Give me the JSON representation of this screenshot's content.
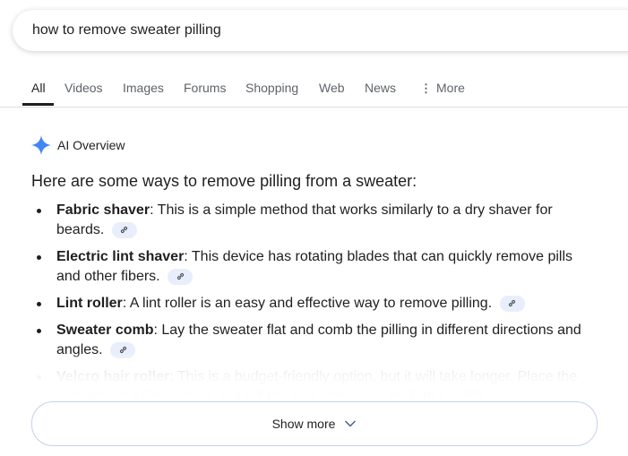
{
  "search": {
    "query": "how to remove sweater pilling"
  },
  "tabs": [
    {
      "label": "All",
      "active": true
    },
    {
      "label": "Videos"
    },
    {
      "label": "Images"
    },
    {
      "label": "Forums"
    },
    {
      "label": "Shopping"
    },
    {
      "label": "Web"
    },
    {
      "label": "News"
    },
    {
      "label": "More",
      "icon": "more-vert-icon"
    }
  ],
  "ai_overview": {
    "label": "AI Overview",
    "icon": "gemini-sparkle-icon",
    "accent_color": "#4285f4",
    "intro": "Here are some ways to remove pilling from a sweater:",
    "items": [
      {
        "title": "Fabric shaver",
        "text": ": This is a simple method that works similarly to a dry shaver for beards.",
        "link_icon": "link-icon"
      },
      {
        "title": "Electric lint shaver",
        "text": ": This device has rotating blades that can quickly remove pills and other fibers.",
        "link_icon": "link-icon"
      },
      {
        "title": "Lint roller",
        "text": ": A lint roller is an easy and effective way to remove pilling.",
        "link_icon": "link-icon"
      },
      {
        "title": "Sweater comb",
        "text": ": Lay the sweater flat and comb the pilling in different directions and angles.",
        "link_icon": "link-icon"
      },
      {
        "title": "Velcro hair roller",
        "text": ": This is a budget-friendly option, but it will take longer. Place the sweater on a flat surface and roll the hair roller over the fabric.",
        "link_icon": "link-icon"
      }
    ],
    "show_more_label": "Show more"
  }
}
